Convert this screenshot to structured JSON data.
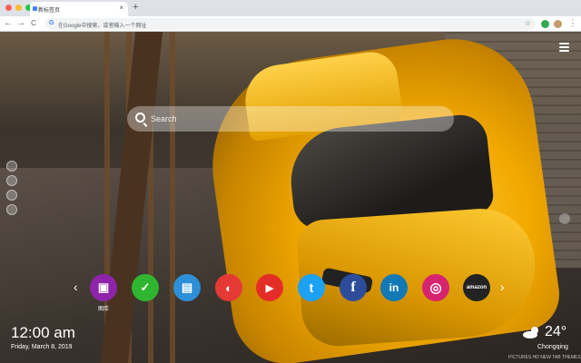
{
  "browser": {
    "tab_title": "新标签页",
    "tab_close": "×",
    "new_tab": "+",
    "back": "←",
    "forward": "→",
    "reload": "C",
    "omnibox_placeholder": "在Google中搜索，或者输入一个网址",
    "omnibox_g": "G",
    "bookmark_star": "☆",
    "menu_dots": "⋮",
    "colors": {
      "close": "#ff5f57",
      "minimize": "#febc2e",
      "maximize": "#28c840"
    }
  },
  "search": {
    "placeholder": "Search"
  },
  "apps": [
    {
      "name": "gallery",
      "label": "图库",
      "glyph": "▣",
      "color": "#8e24aa"
    },
    {
      "name": "checklist",
      "label": "",
      "glyph": "✓",
      "color": "#2fb52f"
    },
    {
      "name": "notes",
      "label": "",
      "glyph": "▤",
      "color": "#2d8fd8"
    },
    {
      "name": "game",
      "label": "",
      "glyph": "◐",
      "color": "#e53935"
    },
    {
      "name": "youtube",
      "label": "",
      "glyph": "▶",
      "color": "#e52d27"
    },
    {
      "name": "twitter",
      "label": "",
      "glyph": "t",
      "color": "#1da1f2"
    },
    {
      "name": "facebook",
      "label": "",
      "glyph": "f",
      "color": "#2d4d9b"
    },
    {
      "name": "linkedin",
      "label": "",
      "glyph": "in",
      "color": "#1279b5"
    },
    {
      "name": "instagram",
      "label": "",
      "glyph": "◎",
      "color": "#d6246e"
    },
    {
      "name": "amazon",
      "label": "",
      "glyph": "amazon",
      "color": "#232323"
    }
  ],
  "nav": {
    "prev": "‹",
    "next": "›"
  },
  "clock": {
    "time": "12:00 am",
    "date": "Friday, March 8, 2019"
  },
  "weather": {
    "temp": "24°",
    "city": "Chongqing",
    "icon": "cloud-sun-icon"
  },
  "watermark": "PICTURES HD NEW TAB THEMES"
}
